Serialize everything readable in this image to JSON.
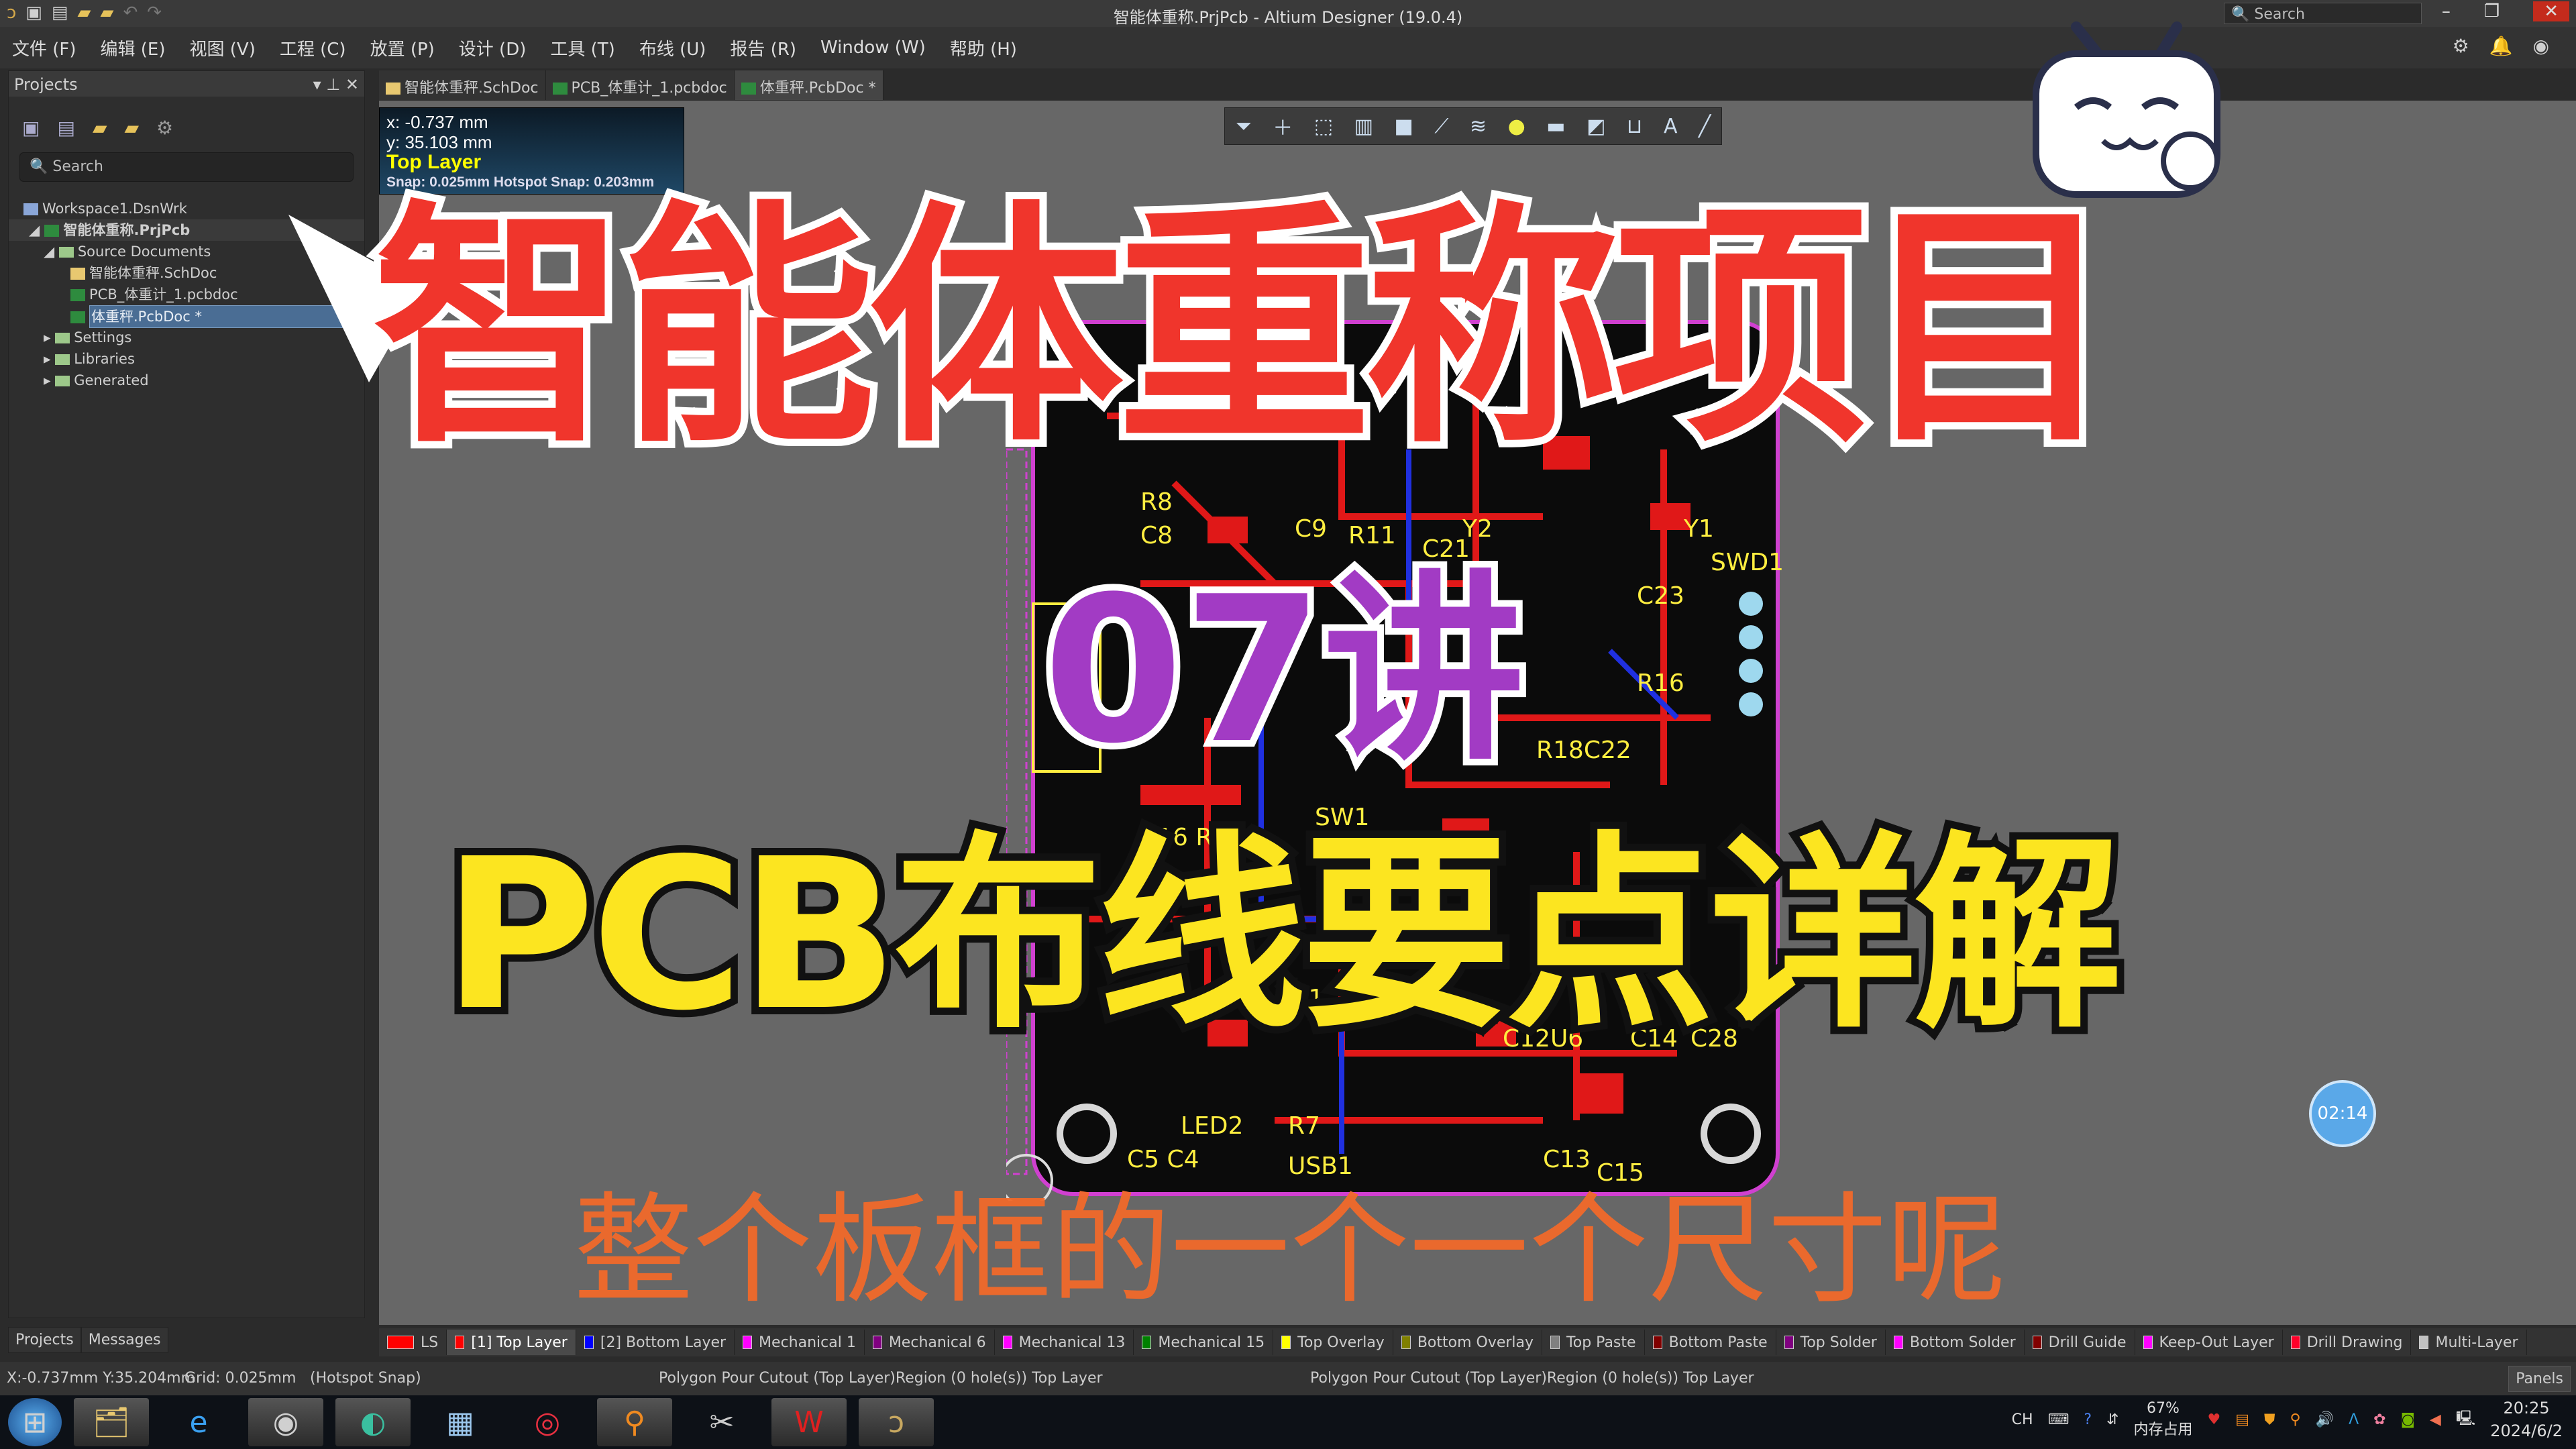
{
  "window": {
    "title": "智能体重称.PrjPcb - Altium Designer (19.0.4)",
    "search_placeholder": "Search",
    "minimize": "–",
    "restore": "❐",
    "close": "✕"
  },
  "menu": [
    "文件 (F)",
    "编辑 (E)",
    "视图 (V)",
    "工程 (C)",
    "放置 (P)",
    "设计 (D)",
    "工具 (T)",
    "布线 (U)",
    "报告 (R)",
    "Window (W)",
    "帮助 (H)"
  ],
  "projects_panel": {
    "title": "Projects",
    "controls": [
      "▾",
      "⊥",
      "✕"
    ],
    "search_placeholder": "Search",
    "tree": {
      "workspace": "Workspace1.DsnWrk",
      "project": "智能体重称.PrjPcb",
      "source_folder": "Source Documents",
      "docs": [
        "智能体重秤.SchDoc",
        "PCB_体重计_1.pcbdoc",
        "体重秤.PcbDoc *"
      ],
      "folders": [
        "Settings",
        "Libraries",
        "Generated"
      ]
    },
    "bottom_tabs": [
      "Projects",
      "Messages"
    ]
  },
  "doc_tabs": [
    {
      "label": "智能体重秤.SchDoc",
      "type": "sch"
    },
    {
      "label": "PCB_体重计_1.pcbdoc",
      "type": "pcb"
    },
    {
      "label": "体重秤.PcbDoc *",
      "type": "pcb",
      "active": true
    }
  ],
  "coord_overlay": {
    "x": "x: -0.737  mm",
    "y": "y: 35.103  mm",
    "layer": "Top Layer",
    "snap": "Snap: 0.025mm Hotspot Snap: 0.203mm"
  },
  "floating_toolbar": [
    "filter-icon",
    "plus-icon",
    "select-rect-icon",
    "align-icon",
    "component-icon",
    "route-icon",
    "diff-pair-icon",
    "pad-icon",
    "fill-icon",
    "polygon-icon",
    "dimension-icon",
    "text-icon",
    "line-icon"
  ],
  "overlay_text": {
    "title": "智能体重称项目",
    "episode": "07讲",
    "subtitle": "PCB布线要点详解",
    "caption": "整个板框的一个一个尺寸呢"
  },
  "timer": "02:14",
  "layers": [
    {
      "label": "LS",
      "color": "#ff0000"
    },
    {
      "label": "[1] Top Layer",
      "color": "#ff0000",
      "active": true
    },
    {
      "label": "[2] Bottom Layer",
      "color": "#0000ff"
    },
    {
      "label": "Mechanical 1",
      "color": "#ff00ff"
    },
    {
      "label": "Mechanical 6",
      "color": "#800080"
    },
    {
      "label": "Mechanical 13",
      "color": "#ff00ff"
    },
    {
      "label": "Mechanical 15",
      "color": "#008000"
    },
    {
      "label": "Top Overlay",
      "color": "#ffff00"
    },
    {
      "label": "Bottom Overlay",
      "color": "#808000"
    },
    {
      "label": "Top Paste",
      "color": "#808080"
    },
    {
      "label": "Bottom Paste",
      "color": "#800000"
    },
    {
      "label": "Top Solder",
      "color": "#800080"
    },
    {
      "label": "Bottom Solder",
      "color": "#ff00ff"
    },
    {
      "label": "Drill Guide",
      "color": "#800000"
    },
    {
      "label": "Keep-Out Layer",
      "color": "#ff00ff"
    },
    {
      "label": "Drill Drawing",
      "color": "#ff002a"
    },
    {
      "label": "Multi-Layer",
      "color": "#c0c0c0"
    }
  ],
  "status": {
    "coords": "X:-0.737mm Y:35.204mm",
    "grid": "Grid: 0.025mm",
    "snap": "(Hotspot Snap)",
    "info1": "Polygon Pour Cutout (Top Layer)Region (0 hole(s)) Top Layer",
    "info2": "Polygon Pour Cutout (Top Layer)Region (0 hole(s)) Top Layer",
    "panels": "Panels"
  },
  "taskbar": {
    "apps": [
      "start-icon",
      "explorer-icon",
      "ie-icon",
      "chrome-icon",
      "edge-dev-icon",
      "calculator-icon",
      "netease-music-icon",
      "search-tool-icon",
      "snipping-icon",
      "wps-icon",
      "altium-icon"
    ],
    "tray": {
      "ime": "CH",
      "memory": "67%",
      "memory_label": "内存占用",
      "time": "20:25",
      "date": "2024/6/2"
    }
  }
}
